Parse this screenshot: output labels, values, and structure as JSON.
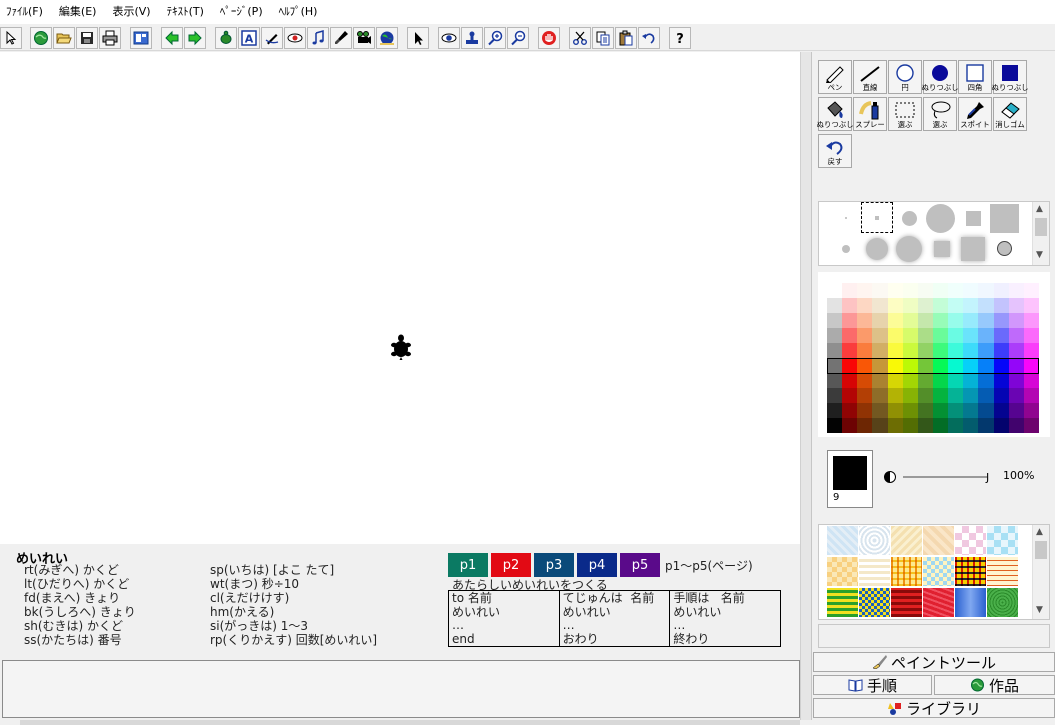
{
  "menu": [
    "ﾌｧｲﾙ(F)",
    "編集(E)",
    "表示(V)",
    "ﾃｷｽﾄ(T)",
    "ﾍﾟｰｼﾞ(P)",
    "ﾍﾙﾌﾟ(H)"
  ],
  "toolbar_icons": [
    "cursor-icon",
    "globe-icon",
    "open-folder-icon",
    "save-icon",
    "print-icon",
    "layout-icon",
    "arrow-left-icon",
    "arrow-right-icon",
    "turtle-icon",
    "text-icon",
    "pen-icon",
    "eye-icon",
    "music-icon",
    "brush-icon",
    "projector-icon",
    "earth-icon",
    "pointer-icon",
    "view-icon",
    "stamp-icon",
    "zoom-in-icon",
    "zoom-out-icon",
    "stop-icon",
    "cut-icon",
    "copy-icon",
    "paste-icon",
    "undo-icon",
    "help-icon"
  ],
  "reference": {
    "title": "めいれい",
    "col1": [
      "rt(みぎへ) かくど",
      "lt(ひだりへ) かくど",
      "fd(まえへ) きょり",
      "bk(うしろへ) きょり",
      "sh(むきは) かくど",
      "ss(かたちは) 番号"
    ],
    "col2": [
      "sp(いちは) [よこ たて]",
      "wt(まつ) 秒÷10",
      "cl(えだけけす)",
      "hm(かえる)",
      "si(がっきは) 1～3",
      "rp(くりかえす) 回数[めいれい]"
    ]
  },
  "pages": [
    {
      "label": "p1",
      "color": "#0b7a63"
    },
    {
      "label": "p2",
      "color": "#e20a14"
    },
    {
      "label": "p3",
      "color": "#0a4a7a"
    },
    {
      "label": "p4",
      "color": "#0a2a8a"
    },
    {
      "label": "p5",
      "color": "#5a0a8a"
    }
  ],
  "page_note": "p1～p5(ページ)",
  "new_command": "あたらしいめいれいをつくる",
  "definitions": [
    [
      "to 名前",
      "めいれい",
      "…",
      "end"
    ],
    [
      "てじゅんは  名前",
      "めいれい",
      "…",
      "おわり"
    ],
    [
      "手順は   名前",
      "めいれい",
      "…",
      "終わり"
    ]
  ],
  "tools": [
    {
      "name": "pen-tool",
      "label": "ペン",
      "icon": "pen-icon"
    },
    {
      "name": "line-tool",
      "label": "直線",
      "icon": "line-icon"
    },
    {
      "name": "circle-tool",
      "label": "円",
      "icon": "circle-icon"
    },
    {
      "name": "filled-circle-tool",
      "label": "ぬりつぶし",
      "icon": "filled-circle-icon"
    },
    {
      "name": "rectangle-tool",
      "label": "四角",
      "icon": "square-icon"
    },
    {
      "name": "filled-rectangle-tool",
      "label": "ぬりつぶし",
      "icon": "filled-square-icon"
    },
    {
      "name": "fill-tool",
      "label": "ぬりつぶし",
      "icon": "paint-bucket-icon"
    },
    {
      "name": "spray-tool",
      "label": "スプレー",
      "icon": "spray-icon"
    },
    {
      "name": "select-rect-tool",
      "label": "選ぶ",
      "icon": "marquee-icon"
    },
    {
      "name": "select-lasso-tool",
      "label": "選ぶ",
      "icon": "lasso-icon"
    },
    {
      "name": "eyedropper-tool",
      "label": "スポイト",
      "icon": "eyedropper-icon"
    },
    {
      "name": "eraser-tool",
      "label": "消しゴム",
      "icon": "eraser-icon"
    },
    {
      "name": "undo-tool",
      "label": "戻す",
      "icon": "undo-icon"
    }
  ],
  "colors": {
    "accent": "#000000",
    "selected_color": "#000000",
    "panel_bg": "#f0f0f0"
  },
  "selected_color_number": "9",
  "opacity": "100%",
  "slider_end": "J",
  "tabs": [
    {
      "label": "ペイントツール",
      "icon": "paint-brush-icon"
    },
    {
      "label": "手順",
      "icon": "book-icon"
    },
    {
      "label": "作品",
      "icon": "globe-icon"
    },
    {
      "label": "ライブラリ",
      "icon": "library-icon"
    }
  ]
}
